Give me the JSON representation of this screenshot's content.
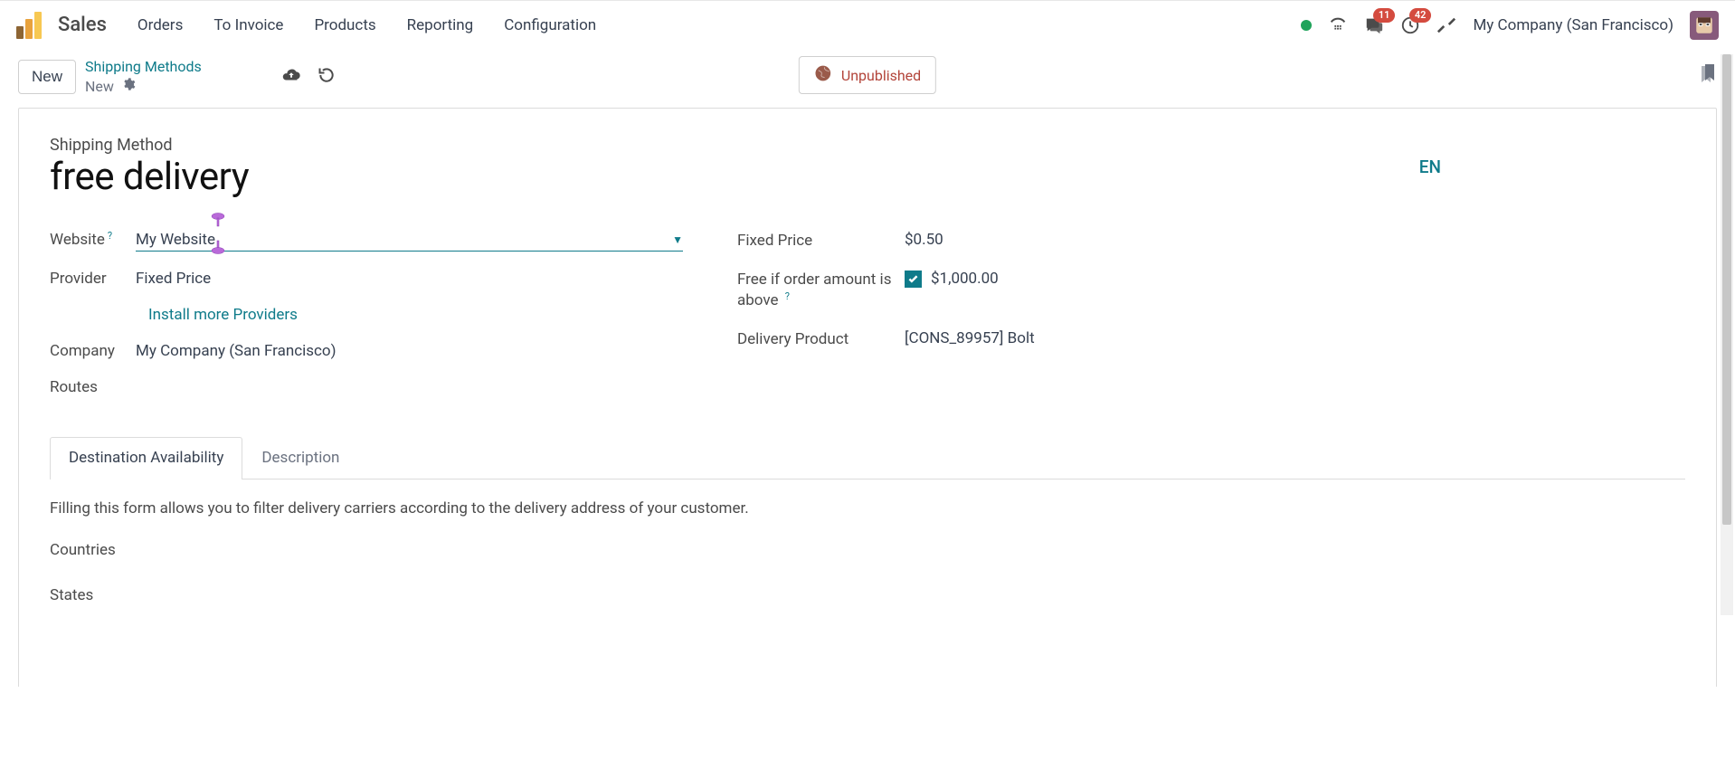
{
  "navbar": {
    "app_name": "Sales",
    "links": [
      "Orders",
      "To Invoice",
      "Products",
      "Reporting",
      "Configuration"
    ],
    "company": "My Company (San Francisco)",
    "badges": {
      "messages": "11",
      "activities": "42"
    }
  },
  "controlbar": {
    "new_btn": "New",
    "breadcrumb_link": "Shipping Methods",
    "breadcrumb_current": "New",
    "unpublished": "Unpublished"
  },
  "form": {
    "section_label": "Shipping Method",
    "title": "free delivery",
    "lang": "EN",
    "labels": {
      "website": "Website",
      "provider": "Provider",
      "company": "Company",
      "routes": "Routes",
      "fixed_price": "Fixed Price",
      "free_if": "Free if order amount is above",
      "delivery_product": "Delivery Product"
    },
    "values": {
      "website": "My Website",
      "provider": "Fixed Price",
      "install_more": "Install more Providers",
      "company": "My Company (San Francisco)",
      "fixed_price": "$0.50",
      "free_if_amount": "$1,000.00",
      "delivery_product": "[CONS_89957] Bolt"
    }
  },
  "tabs": {
    "t1": "Destination Availability",
    "t2": "Description",
    "dest_help": "Filling this form allows you to filter delivery carriers according to the delivery address of your customer.",
    "countries": "Countries",
    "states": "States"
  }
}
